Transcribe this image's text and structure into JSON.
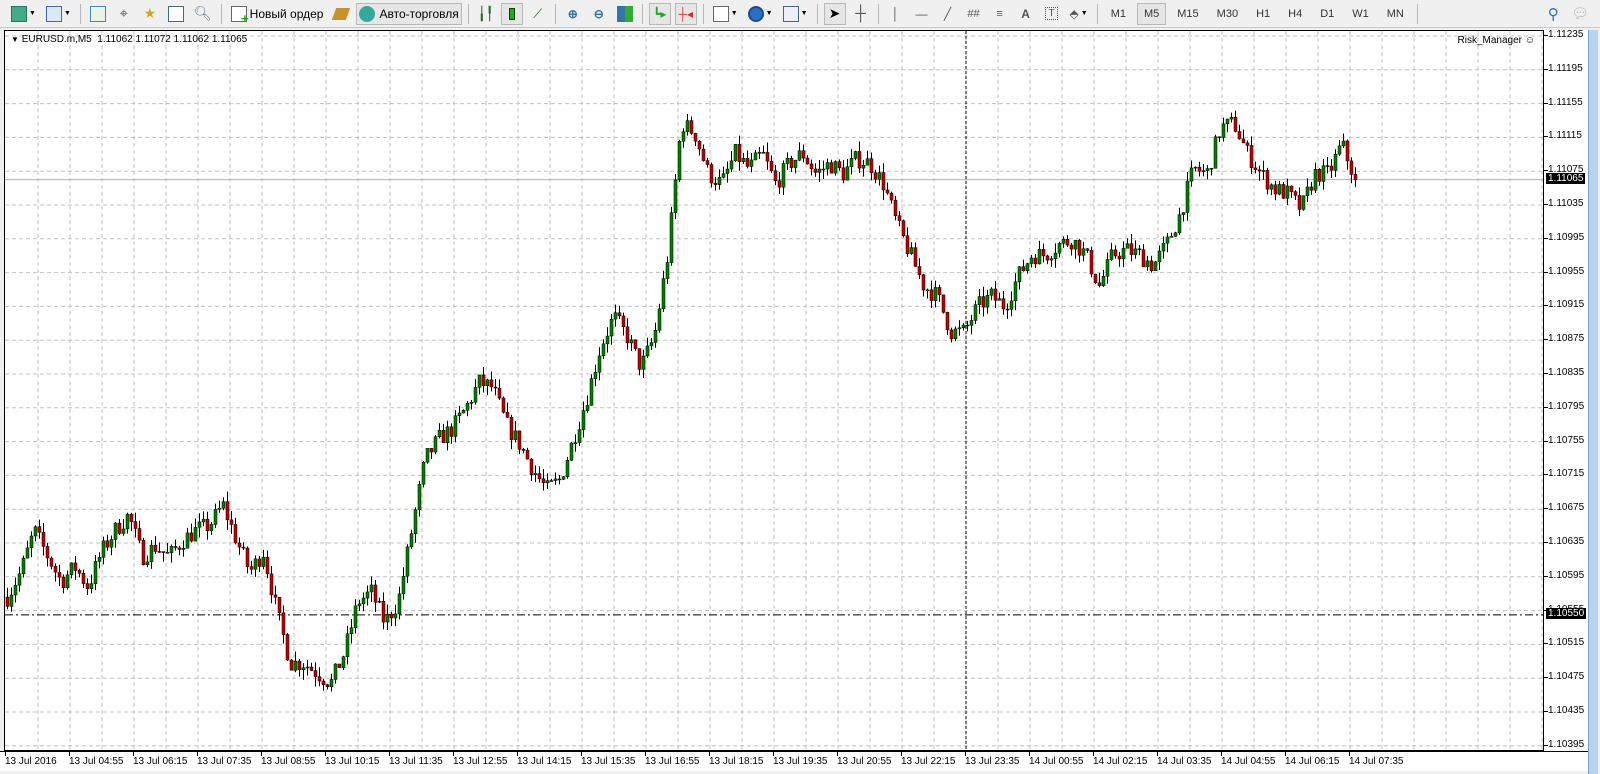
{
  "toolbar": {
    "new_order": "Новый ордер",
    "autotrading": "Авто-торговля",
    "timeframes": [
      "M1",
      "M5",
      "M15",
      "M30",
      "H1",
      "H4",
      "D1",
      "W1",
      "MN"
    ],
    "active_timeframe": "M5"
  },
  "chart": {
    "symbol_info": "EURUSD.m,M5",
    "ohlc": "1.11062 1.11072 1.11062 1.11065",
    "indicator_label": "Risk_Manager",
    "bid_price": "1.11065",
    "level_price": "1.10550",
    "colors": {
      "bull": "#008000",
      "bear": "#c00000",
      "wick": "#000000",
      "grid": "#c0c0c0"
    }
  },
  "price_axis": [
    "1.11235",
    "1.11195",
    "1.11155",
    "1.11115",
    "1.11075",
    "1.11035",
    "1.10995",
    "1.10955",
    "1.10915",
    "1.10875",
    "1.10835",
    "1.10795",
    "1.10755",
    "1.10715",
    "1.10675",
    "1.10635",
    "1.10595",
    "1.10555",
    "1.10515",
    "1.10475",
    "1.10435",
    "1.10395"
  ],
  "time_axis": [
    "13 Jul 2016",
    "13 Jul 04:55",
    "13 Jul 06:15",
    "13 Jul 07:35",
    "13 Jul 08:55",
    "13 Jul 10:15",
    "13 Jul 11:35",
    "13 Jul 12:55",
    "13 Jul 14:15",
    "13 Jul 15:35",
    "13 Jul 16:55",
    "13 Jul 18:15",
    "13 Jul 19:35",
    "13 Jul 20:55",
    "13 Jul 22:15",
    "13 Jul 23:35",
    "14 Jul 00:55",
    "14 Jul 02:15",
    "14 Jul 03:35",
    "14 Jul 04:55",
    "14 Jul 06:15",
    "14 Jul 07:35"
  ],
  "chart_data": {
    "type": "candlestick",
    "symbol": "EURUSD.m",
    "timeframe": "M5",
    "ylim": [
      1.10395,
      1.11235
    ],
    "bar_count": 338,
    "close_keypoints": [
      1.10571,
      1.10601,
      1.1065,
      1.10619,
      1.10589,
      1.10607,
      1.10583,
      1.10625,
      1.1065,
      1.10668,
      1.10619,
      1.10631,
      1.10619,
      1.10638,
      1.1065,
      1.10656,
      1.1068,
      1.10638,
      1.10601,
      1.10625,
      1.10553,
      1.10493,
      1.10493,
      1.10481,
      1.10469,
      1.10505,
      1.10565,
      1.10577,
      1.10541,
      1.10565,
      1.1065,
      1.10734,
      1.10758,
      1.1077,
      1.10794,
      1.10825,
      1.10819,
      1.10776,
      1.10752,
      1.10722,
      1.10698,
      1.1071,
      1.10758,
      1.10807,
      1.10867,
      1.10903,
      1.10879,
      1.10843,
      1.10879,
      1.10976,
      1.11132,
      1.1112,
      1.11072,
      1.1106,
      1.11096,
      1.11078,
      1.11096,
      1.1106,
      1.11084,
      1.11096,
      1.11072,
      1.11084,
      1.11072,
      1.1109,
      1.11084,
      1.1106,
      1.11012,
      1.10976,
      1.10939,
      1.10927,
      1.10885,
      1.10885,
      1.10915,
      1.10927,
      1.10915,
      1.10951,
      1.10976,
      1.10976,
      1.10988,
      1.10994,
      1.10976,
      1.10939,
      1.10976,
      1.10982,
      1.10976,
      1.10963,
      1.10988,
      1.11024,
      1.11078,
      1.11072,
      1.11126,
      1.11132,
      1.11096,
      1.11072,
      1.11054,
      1.11048,
      1.1103,
      1.11072,
      1.11072,
      1.11107,
      1.11065
    ]
  }
}
